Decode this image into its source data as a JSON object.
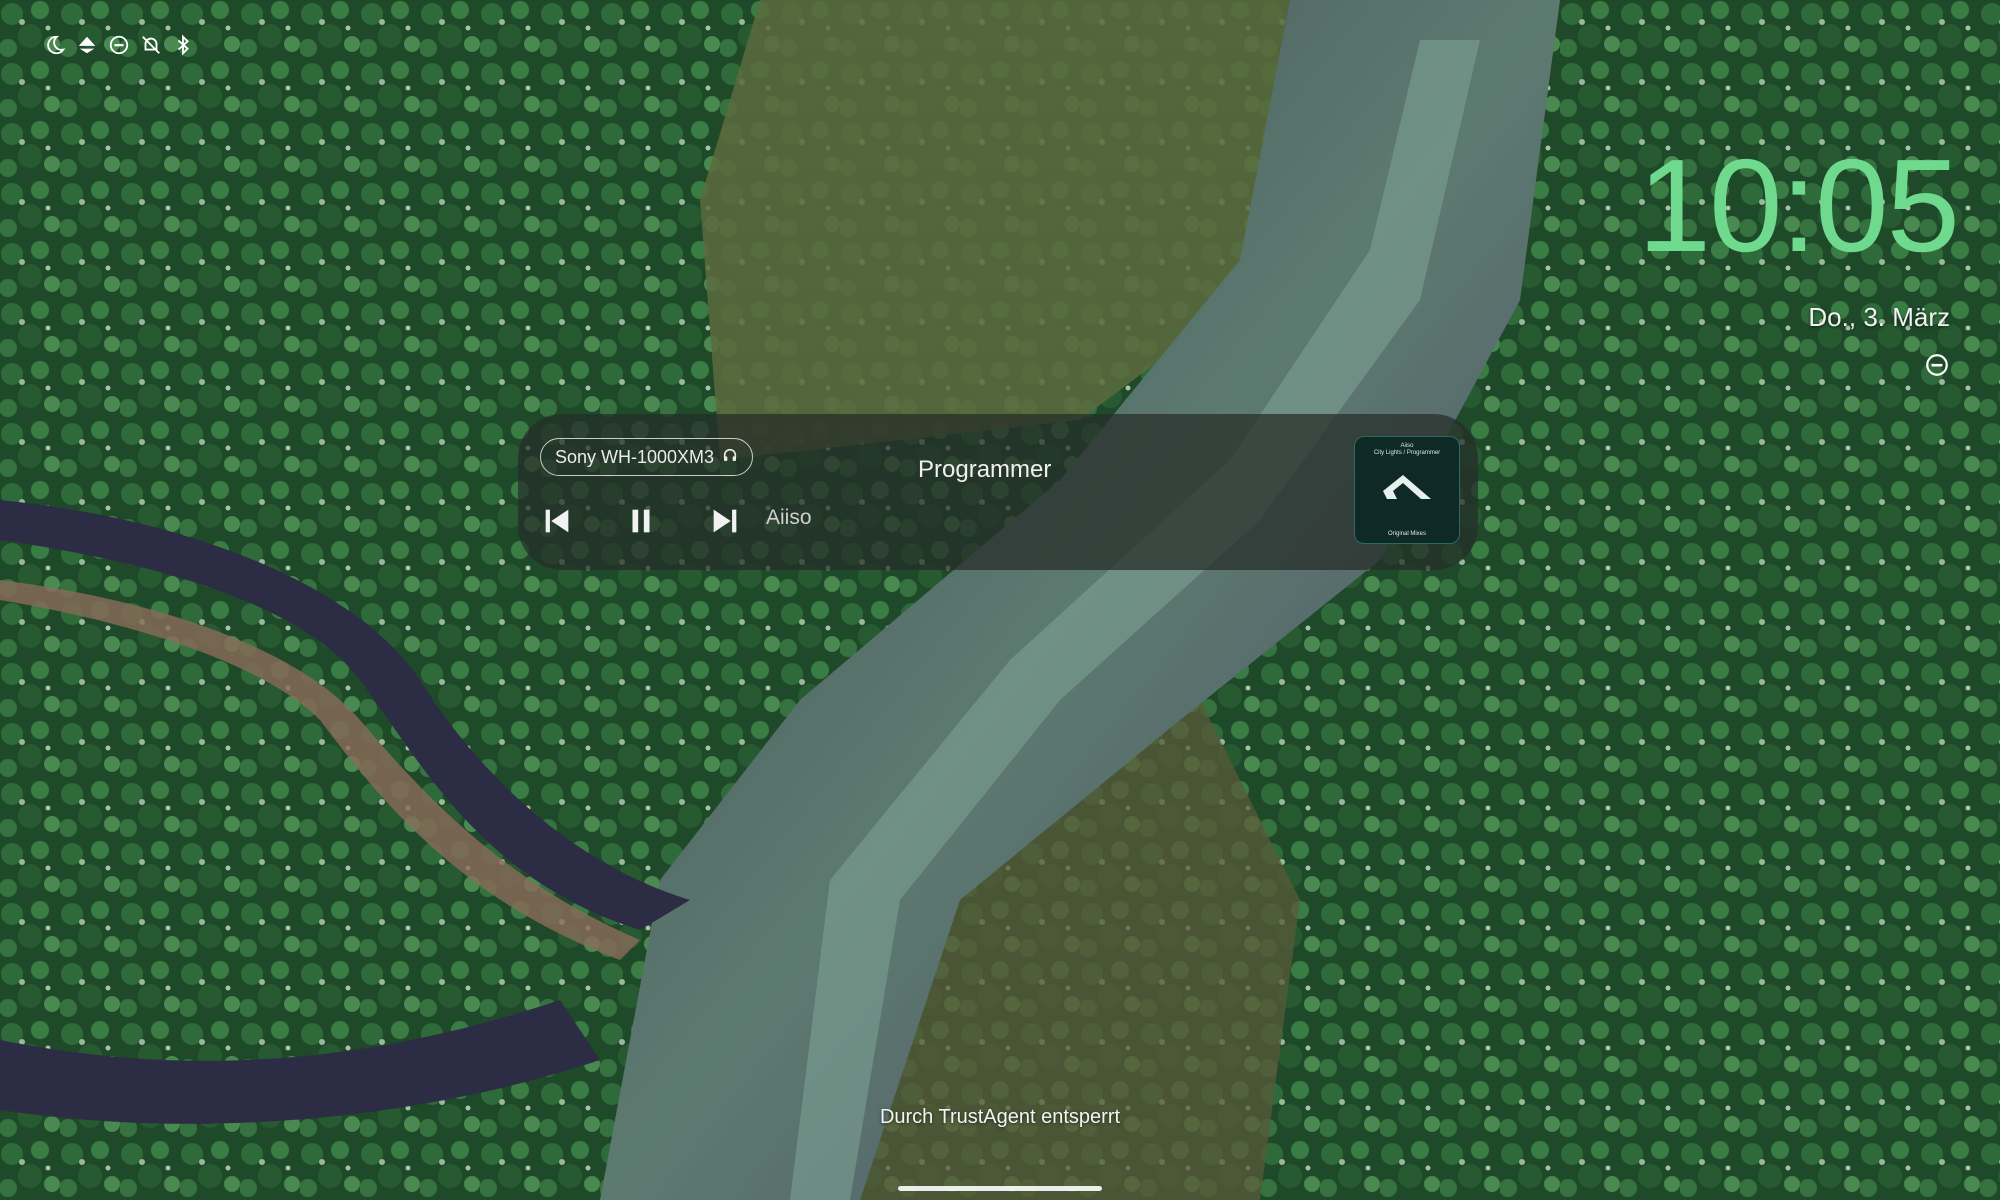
{
  "status_bar": {
    "icons": [
      "moon-icon",
      "data-saver-icon",
      "do-not-disturb-icon",
      "notifications-off-icon",
      "bluetooth-icon"
    ]
  },
  "clock": {
    "time": "10:05",
    "color": "#6fd98e"
  },
  "date": {
    "text": "Do., 3. März"
  },
  "media": {
    "output_device": "Sony WH-1000XM3",
    "output_device_icon": "headphones-icon",
    "title": "Programmer",
    "artist": "Aiiso",
    "controls": [
      "previous-icon",
      "pause-icon",
      "next-icon"
    ],
    "album_art": {
      "top_line1": "Aiiso",
      "top_line2": "City Lights / Programmer",
      "bottom": "Original Mixes"
    }
  },
  "unlock_message": "Durch TrustAgent entsperrt"
}
